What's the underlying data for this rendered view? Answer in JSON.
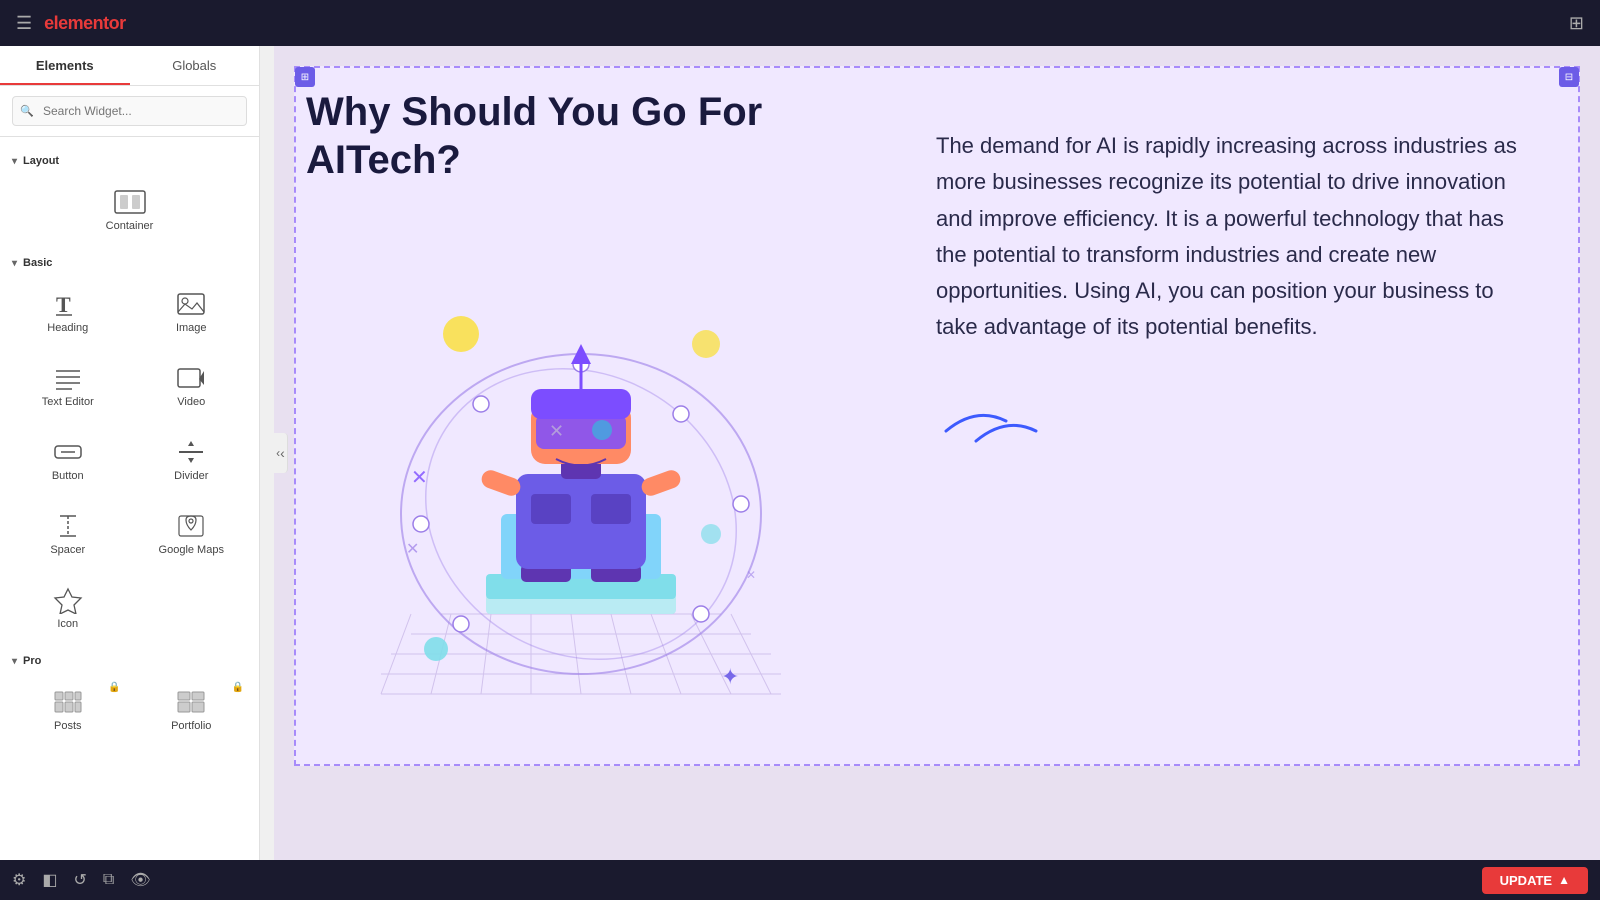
{
  "topbar": {
    "logo": "elementor",
    "hamburger_icon": "☰",
    "grid_icon": "⊞"
  },
  "sidebar": {
    "tabs": [
      {
        "id": "elements",
        "label": "Elements",
        "active": true
      },
      {
        "id": "globals",
        "label": "Globals",
        "active": false
      }
    ],
    "search_placeholder": "Search Widget...",
    "sections": [
      {
        "id": "layout",
        "label": "Layout",
        "widgets": [
          {
            "id": "container",
            "label": "Container",
            "icon": "container"
          }
        ]
      },
      {
        "id": "basic",
        "label": "Basic",
        "widgets": [
          {
            "id": "heading",
            "label": "Heading",
            "icon": "heading"
          },
          {
            "id": "image",
            "label": "Image",
            "icon": "image"
          },
          {
            "id": "text-editor",
            "label": "Text Editor",
            "icon": "text"
          },
          {
            "id": "video",
            "label": "Video",
            "icon": "video"
          },
          {
            "id": "button",
            "label": "Button",
            "icon": "button"
          },
          {
            "id": "divider",
            "label": "Divider",
            "icon": "divider"
          },
          {
            "id": "spacer",
            "label": "Spacer",
            "icon": "spacer"
          },
          {
            "id": "google-maps",
            "label": "Google Maps",
            "icon": "maps"
          },
          {
            "id": "icon",
            "label": "Icon",
            "icon": "icon"
          }
        ]
      },
      {
        "id": "pro",
        "label": "Pro",
        "widgets": [
          {
            "id": "posts",
            "label": "Posts",
            "icon": "posts",
            "locked": true
          },
          {
            "id": "portfolio",
            "label": "Portfolio",
            "icon": "portfolio",
            "locked": true
          }
        ]
      }
    ]
  },
  "canvas": {
    "heading": "Why Should You Go For AITech?",
    "body_text": "The demand for AI is rapidly increasing across industries as more businesses recognize its potential to drive innovation and improve efficiency. It is a powerful technology that has the potential to transform industries and create new opportunities. Using AI, you can position your business to take advantage of its potential benefits.",
    "bg_color": "#ede8f8"
  },
  "bottombar": {
    "update_label": "UPDATE",
    "icons": [
      "settings",
      "layers",
      "history",
      "duplicate",
      "preview"
    ]
  }
}
